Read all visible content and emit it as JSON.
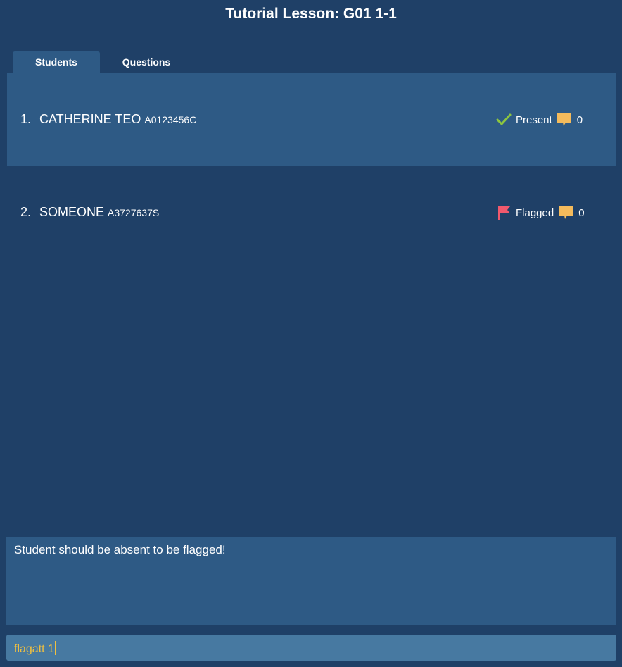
{
  "title": "Tutorial Lesson: G01 1-1",
  "tabs": [
    {
      "label": "Students",
      "active": true
    },
    {
      "label": "Questions",
      "active": false
    }
  ],
  "students": [
    {
      "index": "1.",
      "name": "CATHERINE TEO",
      "matric": "A0123456C",
      "status_label": "Present",
      "status_icon": "check-icon",
      "question_count": "0",
      "selected": true
    },
    {
      "index": "2.",
      "name": "SOMEONE",
      "matric": "A3727637S",
      "status_label": "Flagged",
      "status_icon": "flag-icon",
      "question_count": "0",
      "selected": false
    }
  ],
  "feedback": {
    "message": "Student should be absent to be flagged!"
  },
  "command": {
    "value": "flagatt 1"
  },
  "colors": {
    "background": "#1f4067",
    "panel": "#2e5a85",
    "command_box": "#4779a1",
    "command_text": "#f0c040",
    "check": "#8dc63f",
    "flag": "#f0596d",
    "speech": "#f4bb5c"
  }
}
